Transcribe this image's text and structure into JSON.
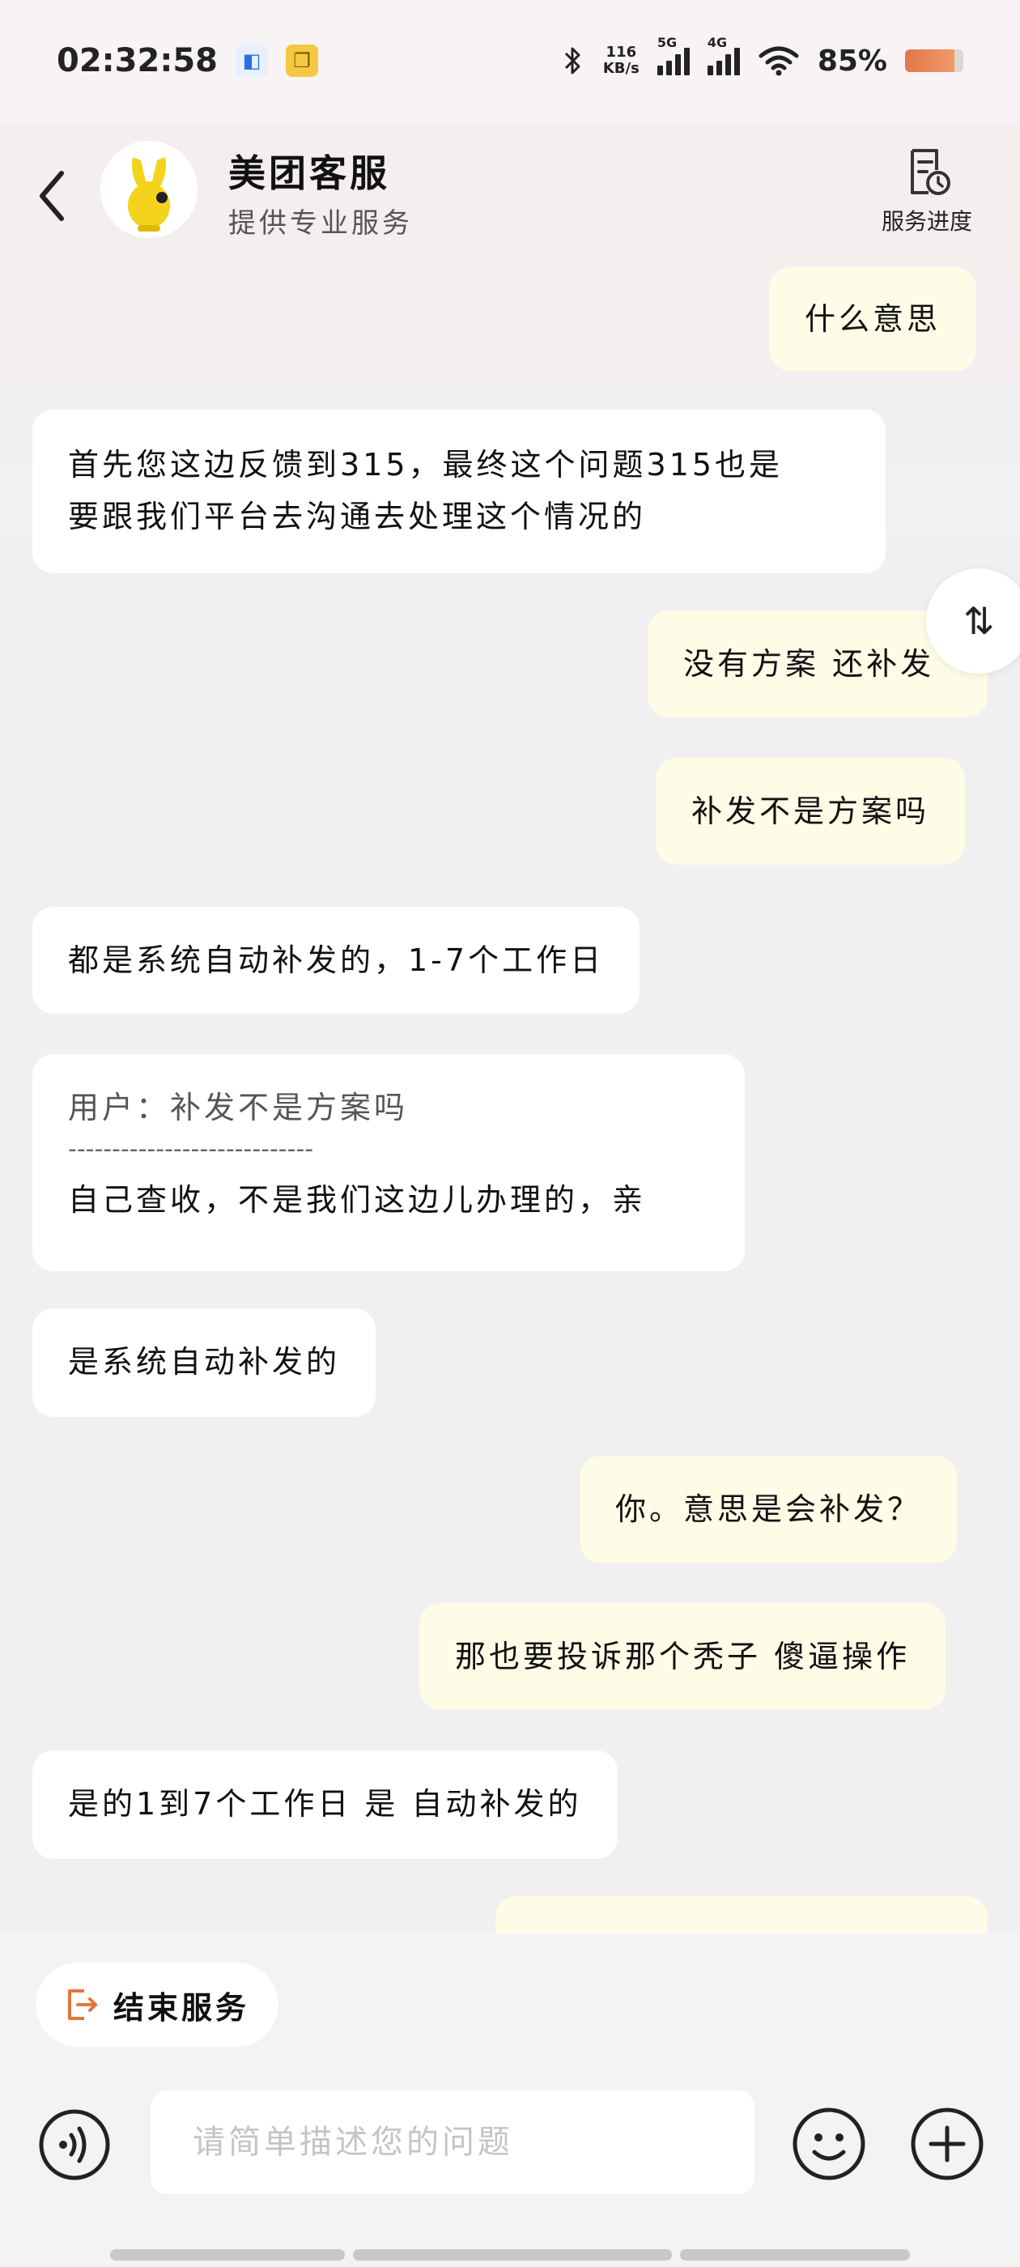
{
  "status_bar": {
    "time": "02:32:58",
    "net_speed_value": "116",
    "net_speed_unit": "KB/s",
    "signal1_label": "5G",
    "signal2_label": "4G",
    "battery": "85%",
    "battery_level": 0.85,
    "accent_color": "#e4764a"
  },
  "header": {
    "title": "美团客服",
    "subtitle": "提供专业服务",
    "progress_label": "服务进度"
  },
  "messages": [
    {
      "side": "right",
      "text": "什么意思"
    },
    {
      "side": "left",
      "lines": [
        "首先您这边反馈到315，最终这个问题315也是",
        "要跟我们平台去沟通去处理这个情况的"
      ]
    },
    {
      "side": "right",
      "text": "没有方案 还补发"
    },
    {
      "side": "right",
      "text": "补发不是方案吗"
    },
    {
      "side": "left",
      "text": "都是系统自动补发的，1-7个工作日"
    },
    {
      "side": "left",
      "quote": "用户：补发不是方案吗",
      "divider": "----------------------------",
      "text": "自己查收，不是我们这边儿办理的，亲"
    },
    {
      "side": "left",
      "text": "是系统自动补发的"
    },
    {
      "side": "right",
      "text": "你。意思是会补发？"
    },
    {
      "side": "right",
      "text": "那也要投诉那个秃子 傻逼操作"
    },
    {
      "side": "left",
      "text": "是的1到7个工作日 是 自动补发的"
    }
  ],
  "side_float_icon": "⇅",
  "bottom": {
    "end_service_label": "结束服务",
    "input_placeholder": "请简单描述您的问题"
  },
  "icons": {
    "back": "chevron-left-icon",
    "progress": "document-clock-icon",
    "voice": "voice-icon",
    "emoji": "emoji-icon",
    "plus": "plus-icon",
    "end": "exit-icon"
  }
}
